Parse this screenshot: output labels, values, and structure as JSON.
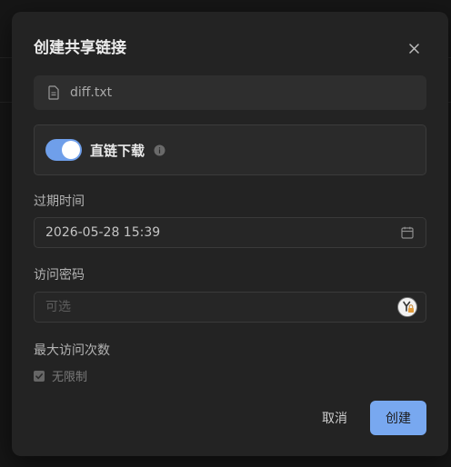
{
  "dialog": {
    "title": "创建共享链接",
    "close_icon": "close-icon"
  },
  "file": {
    "icon": "file-icon",
    "name": "diff.txt"
  },
  "direct_download": {
    "label": "直链下载",
    "enabled": true,
    "info_icon": "info-icon"
  },
  "expiry": {
    "label": "过期时间",
    "value": "2026-05-28 15:39",
    "icon": "calendar-icon"
  },
  "password": {
    "label": "访问密码",
    "placeholder": "可选",
    "extension_icon": "password-manager-icon"
  },
  "max_visits": {
    "label": "最大访问次数",
    "unlimited_label": "无限制",
    "unlimited_checked": true
  },
  "footer": {
    "cancel_label": "取消",
    "create_label": "创建"
  },
  "colors": {
    "accent": "#78a8f0",
    "modal_bg": "#232323"
  }
}
